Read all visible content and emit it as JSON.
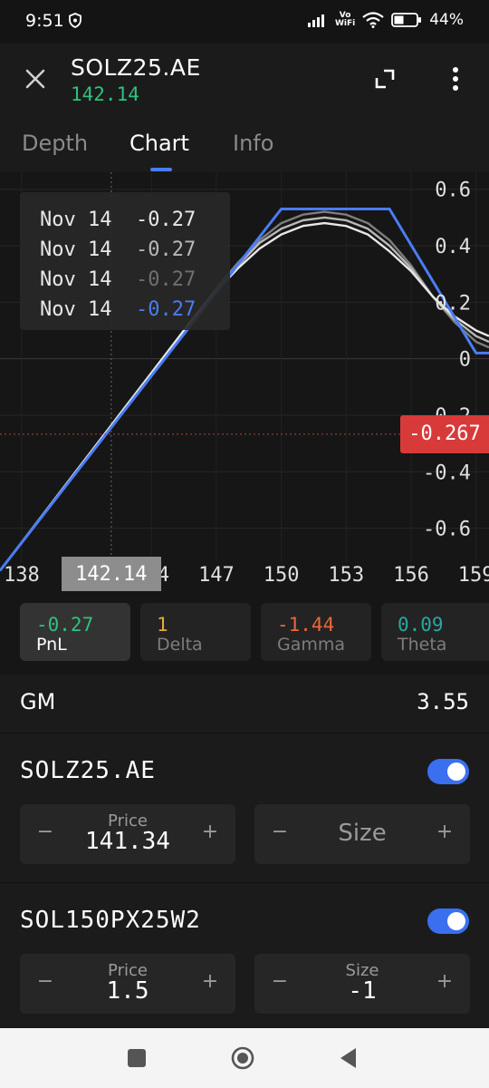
{
  "status": {
    "time": "9:51",
    "battery": "44%",
    "vo_top": "Vo",
    "vo_bottom": "WiFi"
  },
  "header": {
    "title": "SOLZ25.AE",
    "price": "142.14"
  },
  "tabs": [
    {
      "label": "Depth"
    },
    {
      "label": "Chart"
    },
    {
      "label": "Info"
    }
  ],
  "tooltip": {
    "rows": [
      {
        "date": "Nov 14",
        "value": "-0.27",
        "color": "#e8e8e8"
      },
      {
        "date": "Nov 14",
        "value": "-0.27",
        "color": "#b8b8b8"
      },
      {
        "date": "Nov 14",
        "value": "-0.27",
        "color": "#6f6f6f"
      },
      {
        "date": "Nov 14",
        "value": "-0.27",
        "color": "#4a7cf5"
      }
    ]
  },
  "crosshair_label": "142.14",
  "pnl_tag": "-0.267",
  "chart_data": {
    "type": "line",
    "x_ticks": [
      "138",
      "144",
      "147",
      "150",
      "153",
      "156",
      "159"
    ],
    "y_ticks": [
      "0.6",
      "0.4",
      "0.2",
      "0",
      "-0.2",
      "-0.4",
      "-0.6"
    ],
    "xlim": [
      137,
      159.6
    ],
    "ylim": [
      -0.72,
      0.66
    ],
    "crosshair": {
      "x": 142.14,
      "y": -0.267
    },
    "series": [
      {
        "color": "#4a7cf5",
        "x": [
          137,
          150,
          155,
          159,
          159.6
        ],
        "y": [
          -0.75,
          0.53,
          0.53,
          0.02,
          0.02
        ]
      },
      {
        "color": "#e8e8e8",
        "x": [
          137,
          141,
          143,
          144,
          145,
          146,
          147,
          148,
          149,
          150,
          151,
          152,
          153,
          154,
          155,
          156,
          157,
          158,
          159,
          159.6
        ],
        "y": [
          -0.75,
          -0.35,
          -0.15,
          -0.05,
          0.05,
          0.15,
          0.24,
          0.32,
          0.39,
          0.44,
          0.47,
          0.48,
          0.47,
          0.44,
          0.38,
          0.31,
          0.22,
          0.15,
          0.1,
          0.08
        ]
      },
      {
        "color": "#b8b8b8",
        "x": [
          137,
          141,
          143,
          144,
          145,
          146,
          147,
          148,
          149,
          150,
          151,
          152,
          153,
          154,
          155,
          156,
          157,
          158,
          159,
          159.6
        ],
        "y": [
          -0.75,
          -0.35,
          -0.15,
          -0.05,
          0.05,
          0.15,
          0.24,
          0.33,
          0.41,
          0.46,
          0.49,
          0.5,
          0.49,
          0.46,
          0.4,
          0.32,
          0.22,
          0.14,
          0.08,
          0.06
        ]
      },
      {
        "color": "#7d7d7d",
        "x": [
          137,
          141,
          143,
          144,
          145,
          146,
          147,
          148,
          149,
          150,
          151,
          152,
          153,
          154,
          155,
          156,
          157,
          158,
          159,
          159.6
        ],
        "y": [
          -0.75,
          -0.35,
          -0.15,
          -0.05,
          0.05,
          0.15,
          0.25,
          0.34,
          0.42,
          0.48,
          0.51,
          0.52,
          0.51,
          0.48,
          0.42,
          0.33,
          0.22,
          0.13,
          0.06,
          0.04
        ]
      }
    ]
  },
  "greeks": [
    {
      "value": "-0.27",
      "label": "PnL",
      "color": "#2ec27e",
      "selected": true
    },
    {
      "value": "1",
      "label": "Delta",
      "color": "#e6a93a",
      "selected": false
    },
    {
      "value": "-1.44",
      "label": "Gamma",
      "color": "#e8693a",
      "selected": false
    },
    {
      "value": "0.09",
      "label": "Theta",
      "color": "#2aa8a0",
      "selected": false
    }
  ],
  "gm": {
    "label": "GM",
    "value": "3.55"
  },
  "legs": [
    {
      "name": "SOLZ25.AE",
      "enabled": true,
      "price": {
        "label": "Price",
        "value": "141.34"
      },
      "size": {
        "placeholder": "Size",
        "value": ""
      },
      "minus": "−",
      "plus": "+"
    },
    {
      "name": "SOL150PX25W2",
      "enabled": true,
      "price": {
        "label": "Price",
        "value": "1.5"
      },
      "size": {
        "label": "Size",
        "value": "-1"
      },
      "minus": "−",
      "plus": "+"
    }
  ]
}
